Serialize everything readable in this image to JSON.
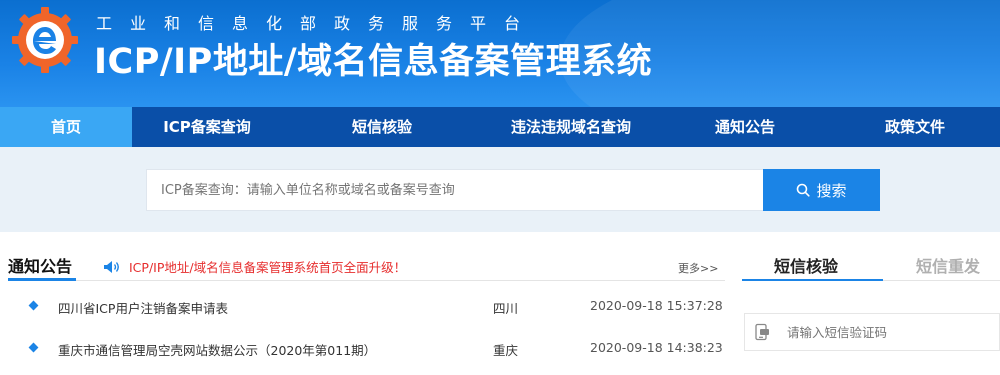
{
  "header": {
    "subtitle": "工业和信息化部政务服务平台",
    "title": "ICP/IP地址/域名信息备案管理系统",
    "logo_icon": "gear-e-logo-icon"
  },
  "nav": {
    "items": [
      {
        "label": "首页",
        "active": true
      },
      {
        "label": "ICP备案查询",
        "active": false
      },
      {
        "label": "短信核验",
        "active": false
      },
      {
        "label": "违法违规域名查询",
        "active": false
      },
      {
        "label": "通知公告",
        "active": false
      },
      {
        "label": "政策文件",
        "active": false
      }
    ]
  },
  "search": {
    "placeholder": "ICP备案查询：请输入单位名称或域名或备案号查询",
    "button_label": "搜索",
    "button_icon": "search-icon"
  },
  "notices": {
    "tab_label": "通知公告",
    "marquee_icon": "speaker-icon",
    "marquee_text": "ICP/IP地址/域名信息备案管理系统首页全面升级！",
    "more_label": "更多>>",
    "items": [
      {
        "title": "四川省ICP用户注销备案申请表",
        "region": "四川",
        "date": "2020-09-18 15:37:28"
      },
      {
        "title": "重庆市通信管理局空壳网站数据公示（2020年第011期）",
        "region": "重庆",
        "date": "2020-09-18 14:38:23"
      }
    ]
  },
  "sms": {
    "tabs": [
      {
        "label": "短信核验",
        "active": true
      },
      {
        "label": "短信重发",
        "active": false
      }
    ],
    "input_icon": "phone-message-icon",
    "input_placeholder": "请输入短信验证码"
  },
  "colors": {
    "header_blue": "#1a82e6",
    "nav_blue": "#0a4fa8",
    "nav_active": "#3aa7f4",
    "accent_blue": "#1b84e6",
    "marquee_red": "#e62d2d",
    "logo_orange": "#f0652a"
  }
}
